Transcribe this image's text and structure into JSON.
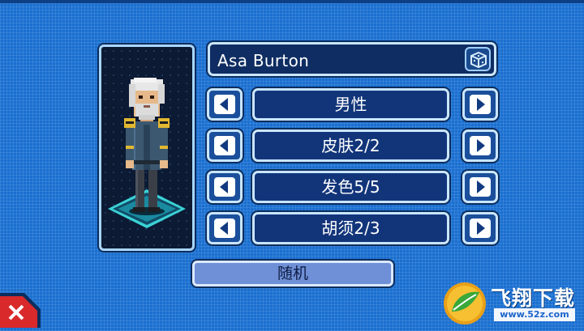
{
  "character": {
    "name": "Asa Burton",
    "randomize_icon": "dice-icon"
  },
  "options": [
    {
      "label": "男性"
    },
    {
      "label": "皮肤2/2"
    },
    {
      "label": "发色5/5"
    },
    {
      "label": "胡须2/3"
    }
  ],
  "random_button": {
    "label": "随机"
  },
  "close_button": {
    "icon": "close-x-icon"
  },
  "watermark": {
    "title": "飞翔下载",
    "url": "www.52z.com"
  },
  "colors": {
    "background": "#1a6fd0",
    "panel": "#12357a",
    "border": "#c9e6ff",
    "close_red": "#d9292b"
  }
}
